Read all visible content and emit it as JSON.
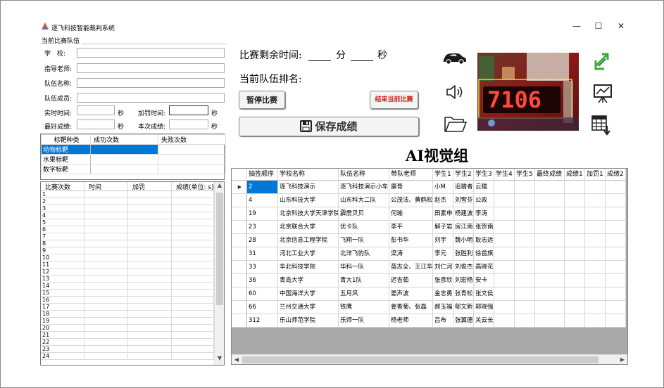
{
  "window": {
    "title": "逐飞科技智能裁判系统",
    "minimize": "—",
    "maximize": "☐",
    "close": "✕"
  },
  "team_panel": {
    "group_label": "当前比赛队伍",
    "school_label": "学　校:",
    "teacher_label": "指导老师:",
    "team_name_label": "队伍名称:",
    "members_label": "队伍成员:",
    "realtime_label": "实时时间:",
    "penalty_label": "加罚时间:",
    "best_label": "最好成绩:",
    "current_label": "本次成绩:",
    "unit_sec": "秒",
    "school_value": "",
    "teacher_value": "",
    "team_name_value": "",
    "members_value": "",
    "realtime_value": "",
    "penalty_value": "",
    "best_value": "",
    "current_value": ""
  },
  "target_table": {
    "headers": [
      "标靶种类",
      "成功次数",
      "失败次数"
    ],
    "rows": [
      {
        "kind": "动物标靶",
        "success": "",
        "fail": ""
      },
      {
        "kind": "水果标靶",
        "success": "",
        "fail": ""
      },
      {
        "kind": "数字标靶",
        "success": "",
        "fail": ""
      }
    ]
  },
  "attempt_table": {
    "headers": [
      "比赛次数",
      "时间",
      "加罚",
      "成绩(单位: s)"
    ],
    "rows": [
      "1",
      "2",
      "3",
      "4",
      "5",
      "6",
      "7",
      "8",
      "9",
      "10",
      "11",
      "12",
      "13",
      "14",
      "15",
      "16",
      "17",
      "18",
      "19",
      "20",
      "21",
      "22",
      "23",
      "24"
    ]
  },
  "timer": {
    "label": "比赛剩余时间:",
    "minute_unit": "分",
    "second_unit": "秒",
    "rank_label": "当前队伍排名:"
  },
  "buttons": {
    "pause": "暂停比赛",
    "end": "结束当前比赛",
    "save": "保存成绩"
  },
  "camera": {
    "display_text": "7106"
  },
  "group_title": "AI视觉组",
  "ranking": {
    "headers": [
      "抽签顺序",
      "学校名称",
      "队伍名称",
      "带队老师",
      "学生1",
      "学生2",
      "学生3",
      "学生4",
      "学生5",
      "最终成绩",
      "成绩1",
      "加罚1",
      "成绩2"
    ],
    "rows": [
      [
        "2",
        "逐飞科技演示",
        "逐飞科技演示小车",
        "康哥",
        "小M",
        "追猎者",
        "云猫"
      ],
      [
        "4",
        "山东科技大学",
        "山东科大二队",
        "公茂法、黄鹤松",
        "赵杰",
        "刘雪芬",
        "公政"
      ],
      [
        "19",
        "北京科技大学天津学院",
        "霹雳贝贝",
        "何瑜",
        "田素申",
        "杨建波",
        "李涛"
      ],
      [
        "23",
        "北京联合大学",
        "优卡队",
        "李平",
        "解子岩",
        "房江南",
        "张贺南"
      ],
      [
        "28",
        "北京信息工程学院",
        "飞翔一队",
        "彭书华",
        "刘宇",
        "魏小明",
        "耿志远"
      ],
      [
        "31",
        "河北工业大学",
        "北洋飞豹队",
        "梁涛",
        "李元",
        "张胜利",
        "徐首旗"
      ],
      [
        "33",
        "华北科技学院",
        "华科一队",
        "苗志全、王江华",
        "刘仁河",
        "刘俊杰",
        "高晓花"
      ],
      [
        "36",
        "青岛大学",
        "青大1队",
        "迟吉茹",
        "张彦欣",
        "刘宏杨",
        "安卡"
      ],
      [
        "60",
        "中国海洋大学",
        "五月风",
        "晏声波",
        "金志勇",
        "张青松",
        "张文侯"
      ],
      [
        "66",
        "兰州交通大学",
        "铁鹰",
        "姜香菊、张磊",
        "郝玉福",
        "郁文新",
        "郭晓强"
      ],
      [
        "312",
        "乐山师范学院",
        "乐师一队",
        "杨老师",
        "吕布",
        "张翼德",
        "关云长"
      ]
    ]
  },
  "colors": {
    "selection": "#0078d7",
    "end_button_text": "#d02020",
    "refresh_icon": "#3aaa35"
  },
  "icons": [
    "car-icon",
    "speaker-icon",
    "folder-icon",
    "refresh-icon",
    "presentation-icon",
    "table-export-icon",
    "save-disk-icon",
    "app-logo-icon"
  ]
}
